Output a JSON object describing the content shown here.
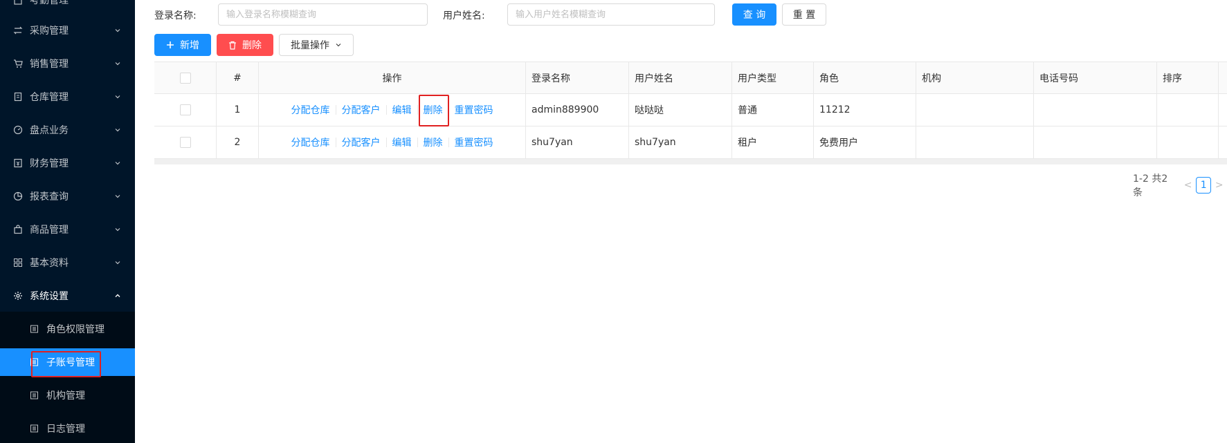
{
  "sidebar": {
    "items": [
      {
        "label": "考勤管理",
        "icon": "building-icon"
      },
      {
        "label": "采购管理",
        "icon": "swap-icon"
      },
      {
        "label": "销售管理",
        "icon": "cart-icon"
      },
      {
        "label": "仓库管理",
        "icon": "book-icon"
      },
      {
        "label": "盘点业务",
        "icon": "dashboard-icon"
      },
      {
        "label": "财务管理",
        "icon": "account-book-icon"
      },
      {
        "label": "报表查询",
        "icon": "pie-chart-icon"
      },
      {
        "label": "商品管理",
        "icon": "shopping-icon"
      },
      {
        "label": "基本资料",
        "icon": "appstore-icon"
      },
      {
        "label": "系统设置",
        "icon": "setting-icon"
      }
    ],
    "submenu": [
      {
        "label": "角色权限管理",
        "icon": "profile-icon"
      },
      {
        "label": "子账号管理",
        "icon": "profile-icon",
        "active": true
      },
      {
        "label": "机构管理",
        "icon": "profile-icon"
      },
      {
        "label": "日志管理",
        "icon": "profile-icon"
      }
    ]
  },
  "search": {
    "login_name_label": "登录名称:",
    "login_name_placeholder": "输入登录名称模糊查询",
    "user_name_label": "用户姓名:",
    "user_name_placeholder": "输入用户姓名模糊查询",
    "query_button": "查 询",
    "reset_button": "重 置"
  },
  "toolbar": {
    "add_button": "新增",
    "delete_button": "删除",
    "batch_button": "批量操作"
  },
  "table": {
    "columns": [
      "#",
      "操作",
      "登录名称",
      "用户姓名",
      "用户类型",
      "角色",
      "机构",
      "电话号码",
      "排序"
    ],
    "actions": [
      "分配仓库",
      "分配客户",
      "编辑",
      "删除",
      "重置密码"
    ],
    "rows": [
      {
        "index": "1",
        "login_name": "admin889900",
        "user_name": "哒哒哒",
        "user_type": "普通",
        "role": "11212",
        "org": "",
        "phone": "",
        "sort": ""
      },
      {
        "index": "2",
        "login_name": "shu7yan",
        "user_name": "shu7yan",
        "user_type": "租户",
        "role": "免费用户",
        "org": "",
        "phone": "",
        "sort": ""
      }
    ]
  },
  "pagination": {
    "total_text": "1-2 共2条",
    "current_page": "1",
    "prev_symbol": "<",
    "next_symbol": ">"
  },
  "colors": {
    "sidebar_bg": "#001529",
    "submenu_bg": "#000c17",
    "primary": "#1890ff",
    "danger": "#ff4d4f",
    "highlight": "#e02020"
  }
}
